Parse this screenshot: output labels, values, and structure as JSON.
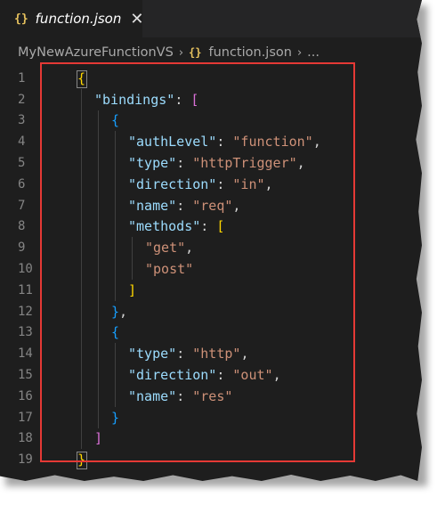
{
  "tab": {
    "icon": "{}",
    "label": "function.json",
    "close": "✕"
  },
  "breadcrumb": {
    "root": "MyNewAzureFunctionVS",
    "sep": "›",
    "file_icon": "{}",
    "file": "function.json",
    "more": "..."
  },
  "lines": [
    {
      "n": "1",
      "indent": 0,
      "tokens": [
        [
          "b1",
          "{"
        ]
      ]
    },
    {
      "n": "2",
      "indent": 1,
      "tokens": [
        [
          "k",
          "\"bindings\""
        ],
        [
          "p",
          ": "
        ],
        [
          "b2",
          "["
        ]
      ]
    },
    {
      "n": "3",
      "indent": 2,
      "tokens": [
        [
          "b3",
          "{"
        ]
      ]
    },
    {
      "n": "4",
      "indent": 3,
      "tokens": [
        [
          "k",
          "\"authLevel\""
        ],
        [
          "p",
          ": "
        ],
        [
          "s",
          "\"function\""
        ],
        [
          "p",
          ","
        ]
      ]
    },
    {
      "n": "5",
      "indent": 3,
      "tokens": [
        [
          "k",
          "\"type\""
        ],
        [
          "p",
          ": "
        ],
        [
          "s",
          "\"httpTrigger\""
        ],
        [
          "p",
          ","
        ]
      ]
    },
    {
      "n": "6",
      "indent": 3,
      "tokens": [
        [
          "k",
          "\"direction\""
        ],
        [
          "p",
          ": "
        ],
        [
          "s",
          "\"in\""
        ],
        [
          "p",
          ","
        ]
      ]
    },
    {
      "n": "7",
      "indent": 3,
      "tokens": [
        [
          "k",
          "\"name\""
        ],
        [
          "p",
          ": "
        ],
        [
          "s",
          "\"req\""
        ],
        [
          "p",
          ","
        ]
      ]
    },
    {
      "n": "8",
      "indent": 3,
      "tokens": [
        [
          "k",
          "\"methods\""
        ],
        [
          "p",
          ": "
        ],
        [
          "b1",
          "["
        ]
      ]
    },
    {
      "n": "9",
      "indent": 4,
      "tokens": [
        [
          "s",
          "\"get\""
        ],
        [
          "p",
          ","
        ]
      ]
    },
    {
      "n": "10",
      "indent": 4,
      "tokens": [
        [
          "s",
          "\"post\""
        ]
      ]
    },
    {
      "n": "11",
      "indent": 3,
      "tokens": [
        [
          "b1",
          "]"
        ]
      ]
    },
    {
      "n": "12",
      "indent": 2,
      "tokens": [
        [
          "b3",
          "}"
        ],
        [
          "p",
          ","
        ]
      ]
    },
    {
      "n": "13",
      "indent": 2,
      "tokens": [
        [
          "b3",
          "{"
        ]
      ]
    },
    {
      "n": "14",
      "indent": 3,
      "tokens": [
        [
          "k",
          "\"type\""
        ],
        [
          "p",
          ": "
        ],
        [
          "s",
          "\"http\""
        ],
        [
          "p",
          ","
        ]
      ]
    },
    {
      "n": "15",
      "indent": 3,
      "tokens": [
        [
          "k",
          "\"direction\""
        ],
        [
          "p",
          ": "
        ],
        [
          "s",
          "\"out\""
        ],
        [
          "p",
          ","
        ]
      ]
    },
    {
      "n": "16",
      "indent": 3,
      "tokens": [
        [
          "k",
          "\"name\""
        ],
        [
          "p",
          ": "
        ],
        [
          "s",
          "\"res\""
        ]
      ]
    },
    {
      "n": "17",
      "indent": 2,
      "tokens": [
        [
          "b3",
          "}"
        ]
      ]
    },
    {
      "n": "18",
      "indent": 1,
      "tokens": [
        [
          "b2",
          "]"
        ]
      ]
    },
    {
      "n": "19",
      "indent": 0,
      "tokens": [
        [
          "b1",
          "}"
        ]
      ]
    }
  ],
  "colors": {
    "key": "#9cdcfe",
    "string": "#ce9178",
    "highlight_border": "#e53935",
    "editor_bg": "#1e1e1e"
  }
}
